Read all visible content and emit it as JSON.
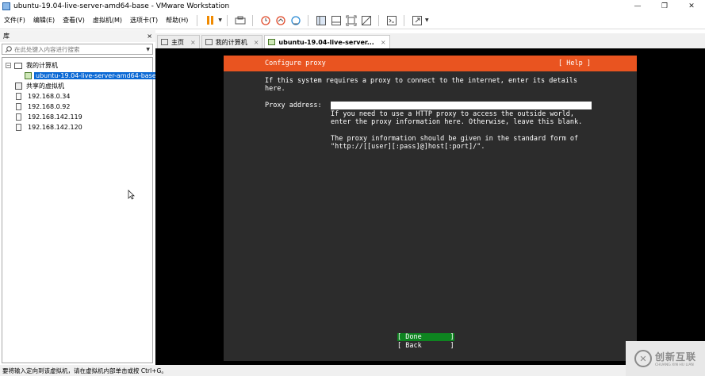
{
  "window": {
    "title": "ubuntu-19.04-live-server-amd64-base - VMware Workstation",
    "minimize": "—",
    "maximize": "❐",
    "close": "✕"
  },
  "menu": [
    "文件(F)",
    "编辑(E)",
    "查看(V)",
    "虚拟机(M)",
    "选项卡(T)",
    "帮助(H)"
  ],
  "library": {
    "title": "库",
    "close": "×",
    "search_placeholder": "在此处键入内容进行搜索",
    "my_computer": "我的计算机",
    "selected_vm": "ubuntu-19.04-live-server-amd64-base",
    "shared": "共享的虚拟机",
    "hosts": [
      "192.168.0.34",
      "192.168.0.92",
      "192.168.142.119",
      "192.168.142.120"
    ]
  },
  "tabs": [
    {
      "label": "主页",
      "close": "×"
    },
    {
      "label": "我的计算机",
      "close": "×"
    },
    {
      "label": "ubuntu-19.04-live-server...",
      "close": "×"
    }
  ],
  "console": {
    "header_title": "Configure proxy",
    "help": "[ Help ]",
    "intro_line1": "If this system requires a proxy to connect to the internet, enter its details",
    "intro_line2": "here.",
    "proxy_label": "Proxy address:",
    "hint_line1": "If you need to use a HTTP proxy to access the outside world,",
    "hint_line2": "enter the proxy information here. Otherwise, leave this blank.",
    "form_line1": "The proxy information should be given in the standard form of",
    "form_line2": "\"http://[[user][:pass]@]host[:port]/\".",
    "done": "[ Done       ]",
    "back": "[ Back       ]"
  },
  "status": {
    "text": "要将输入定向到该虚拟机，请在虚拟机内部单击或按 Ctrl+G。"
  },
  "watermark": {
    "logo": "✕",
    "cn": "创新互联",
    "en": "CHUANG XIN HU LIAN"
  },
  "colors": {
    "ubuntu_orange": "#e95420",
    "console_bg": "#2c2c2c",
    "done_green": "#0e8420",
    "selection_blue": "#0a68d4"
  }
}
